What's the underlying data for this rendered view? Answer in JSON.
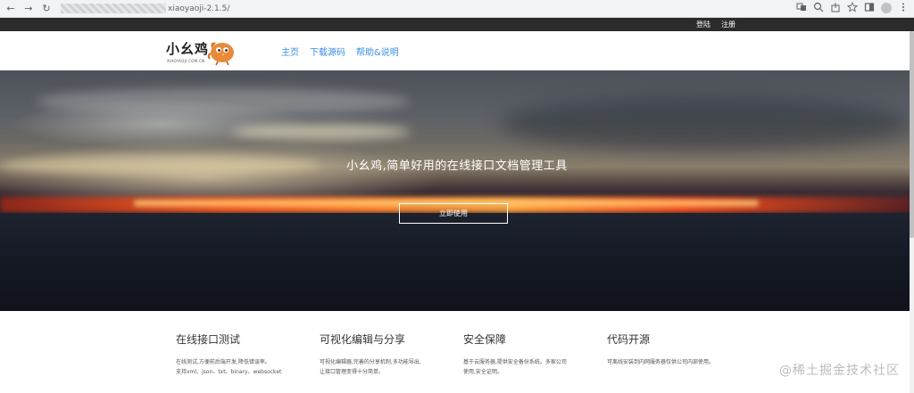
{
  "browser": {
    "back_icon": "←",
    "forward_icon": "→",
    "reload_icon": "↻",
    "url_suffix": "xiaoyaoji-2.1.5/"
  },
  "topbar": {
    "login": "登陆",
    "register": "注册"
  },
  "header": {
    "logo_text": "小幺鸡",
    "logo_sub": "XIAOYAOJI.COM.CN",
    "nav": [
      "主页",
      "下载源码",
      "帮助&说明"
    ]
  },
  "hero": {
    "title": "小幺鸡,简单好用的在线接口文档管理工具",
    "button": "立即使用"
  },
  "features": [
    {
      "title": "在线接口测试",
      "desc": [
        "在线测试,方便前后端开发,降低错误率。",
        "支持xml、json、txt、binary、websocket"
      ]
    },
    {
      "title": "可视化编辑与分享",
      "desc": [
        "可视化编辑器,完善的分享机制,多功能导出,",
        "让接口管理变得十分简单。"
      ]
    },
    {
      "title": "安全保障",
      "desc": [
        "基于云服务器,提供安全备份系统。多家公司",
        "使用,安全证明。"
      ]
    },
    {
      "title": "代码开源",
      "desc": [
        "可离线安装到内网服务器仅供公司内部使用。"
      ]
    }
  ],
  "watermark": "@稀土掘金技术社区",
  "colors": {
    "nav_link": "#3a8ee6",
    "topbar_bg": "#2b2b2b"
  }
}
